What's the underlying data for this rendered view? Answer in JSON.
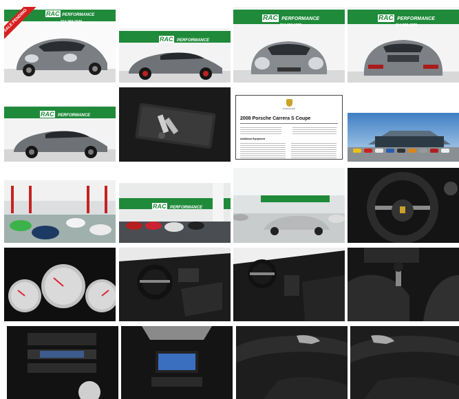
{
  "dealer": {
    "name": "RAC PERFORMANCE",
    "logo_mark": "RAC",
    "logo_word": "PERFORMANCE",
    "phone": "214-269-1570",
    "brand_green": "#1f8a3a",
    "sale_ribbon": "SALE PENDING",
    "ribbon_color": "#d62020"
  },
  "window_sticker": {
    "title": "2008 Porsche Carrera S Coupe",
    "section": "Additional Equipment"
  },
  "gallery": {
    "photos": [
      {
        "label": "front three-quarter view",
        "icon": "car-front-quarter-photo"
      },
      {
        "label": "side profile view",
        "icon": "car-side-photo"
      },
      {
        "label": "front view",
        "icon": "car-front-photo"
      },
      {
        "label": "rear view",
        "icon": "car-rear-photo"
      },
      {
        "label": "side profile view",
        "icon": "car-side-photo"
      },
      {
        "label": "keys and owner manual",
        "icon": "keys-photo"
      },
      {
        "label": "window sticker",
        "icon": "document-photo"
      },
      {
        "label": "dealership exterior",
        "icon": "building-photo"
      },
      {
        "label": "service bay",
        "icon": "showroom-photo"
      },
      {
        "label": "showroom",
        "icon": "showroom-photo"
      },
      {
        "label": "showroom",
        "icon": "showroom-photo"
      },
      {
        "label": "steering wheel",
        "icon": "steering-wheel-photo"
      },
      {
        "label": "instrument cluster",
        "icon": "gauges-photo"
      },
      {
        "label": "cockpit",
        "icon": "interior-photo"
      },
      {
        "label": "dashboard",
        "icon": "interior-photo"
      },
      {
        "label": "center console and shifter",
        "icon": "shifter-photo"
      },
      {
        "label": "climate controls",
        "icon": "console-photo"
      },
      {
        "label": "navigation head unit",
        "icon": "radio-photo"
      },
      {
        "label": "door panel",
        "icon": "door-panel-photo"
      },
      {
        "label": "door panel",
        "icon": "door-panel-photo"
      }
    ]
  }
}
